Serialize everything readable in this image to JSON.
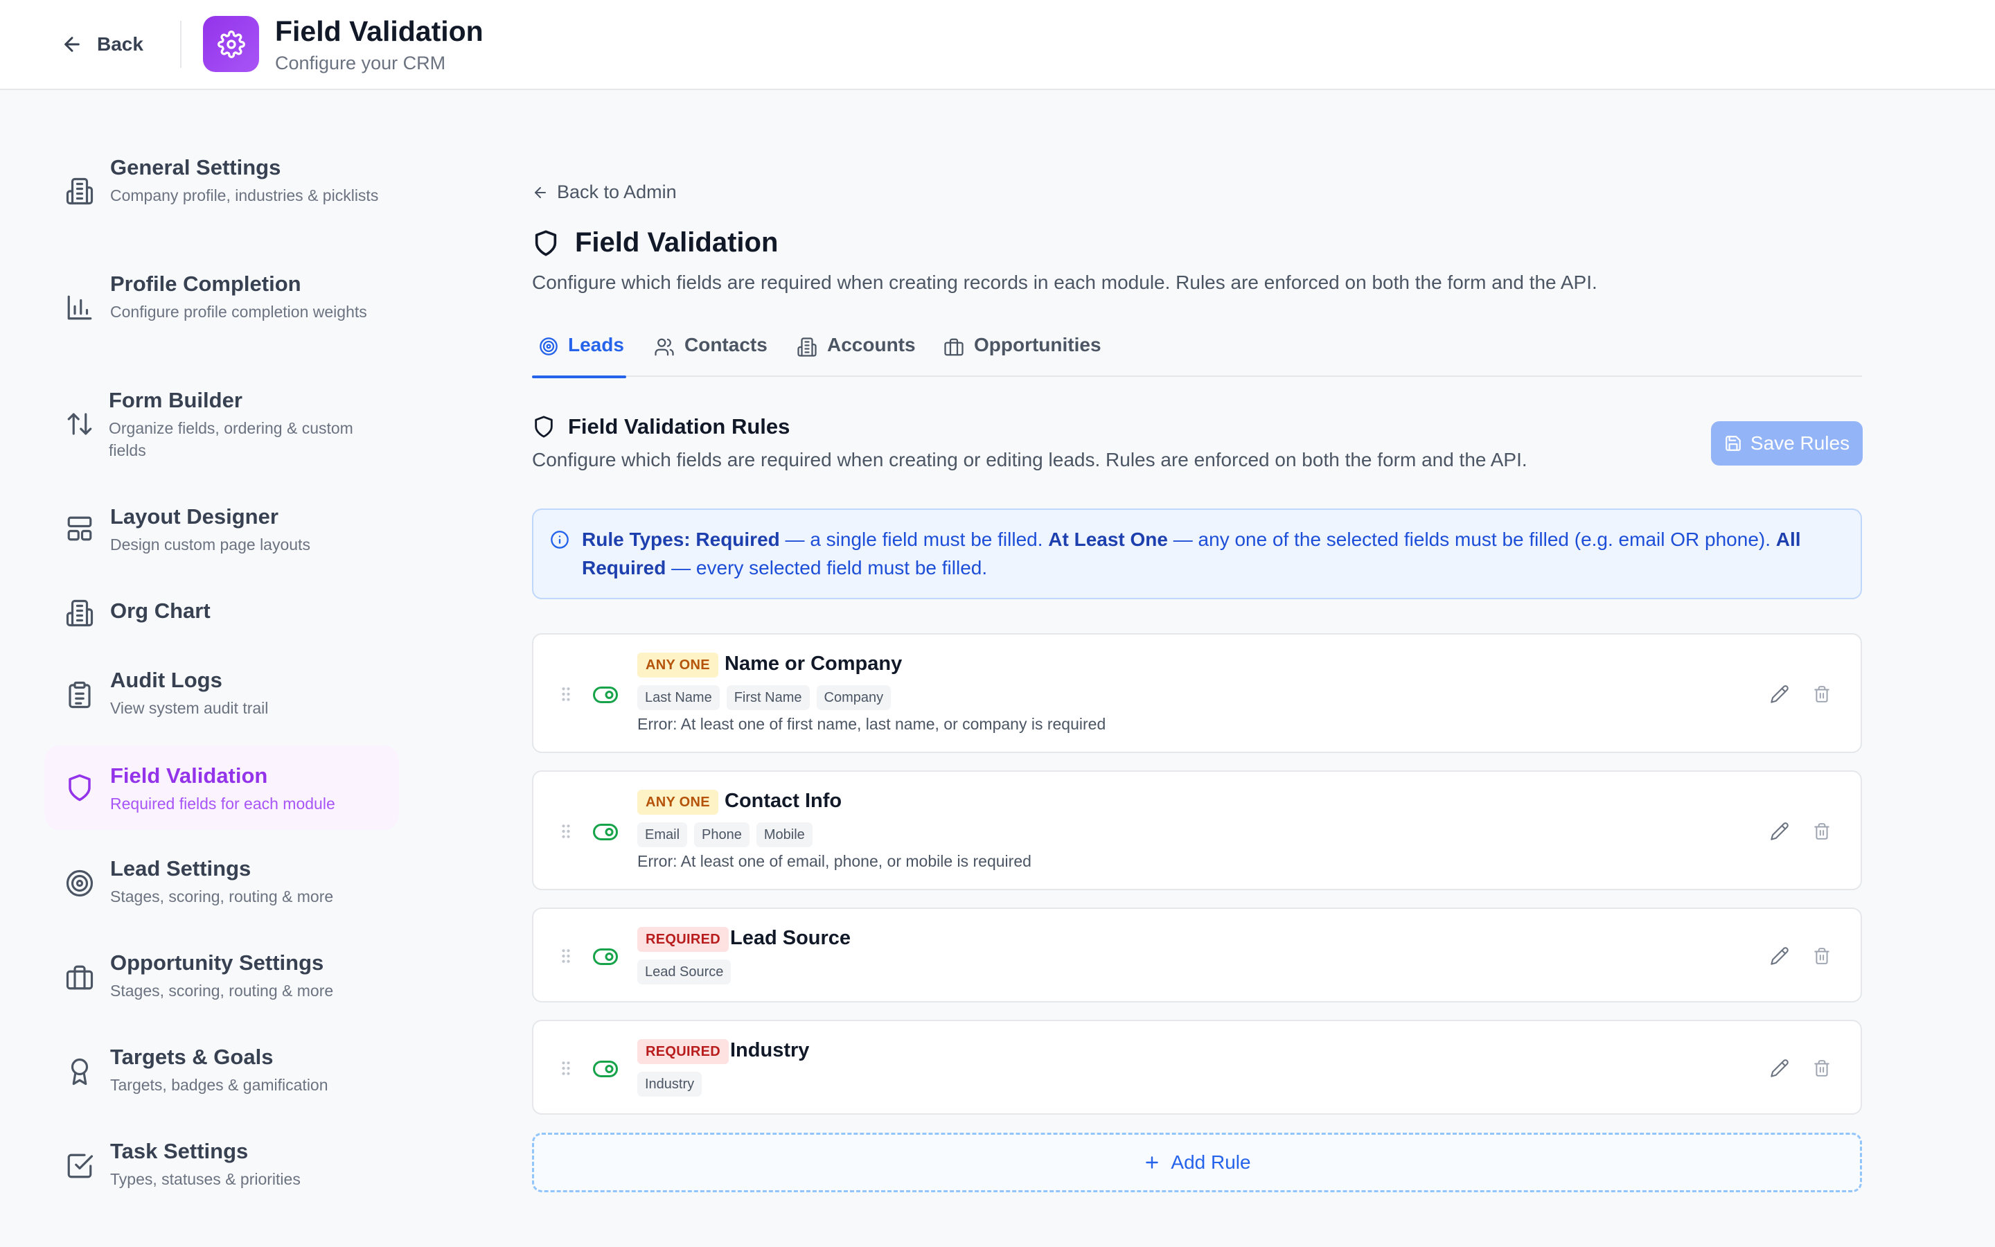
{
  "header": {
    "back_label": "Back",
    "title": "Field Validation",
    "subtitle": "Configure your CRM",
    "app_icon": "gear-icon"
  },
  "sidebar": {
    "items": [
      {
        "label": "General Settings",
        "desc": "Company profile, industries & picklists",
        "icon": "building-icon"
      },
      {
        "label": "Profile Completion",
        "desc": "Configure profile completion weights",
        "icon": "bar-chart-icon"
      },
      {
        "label": "Form Builder",
        "desc": "Organize fields, ordering & custom fields",
        "icon": "sort-arrows-icon"
      },
      {
        "label": "Layout Designer",
        "desc": "Design custom page layouts",
        "icon": "layout-icon"
      },
      {
        "label": "Org Chart",
        "desc": "",
        "icon": "building-icon"
      },
      {
        "label": "Audit Logs",
        "desc": "View system audit trail",
        "icon": "clipboard-icon"
      },
      {
        "label": "Field Validation",
        "desc": "Required fields for each module",
        "icon": "shield-icon",
        "active": true
      },
      {
        "label": "Lead Settings",
        "desc": "Stages, scoring, routing & more",
        "icon": "target-icon"
      },
      {
        "label": "Opportunity Settings",
        "desc": "Stages, scoring, routing & more",
        "icon": "briefcase-icon"
      },
      {
        "label": "Targets & Goals",
        "desc": "Targets, badges & gamification",
        "icon": "award-icon"
      },
      {
        "label": "Task Settings",
        "desc": "Types, statuses & priorities",
        "icon": "check-square-icon"
      }
    ]
  },
  "main": {
    "back_admin": "Back to Admin",
    "title": "Field Validation",
    "description": "Configure which fields are required when creating records in each module. Rules are enforced on both the form and the API.",
    "tabs": [
      {
        "label": "Leads",
        "icon": "target-icon",
        "active": true
      },
      {
        "label": "Contacts",
        "icon": "users-icon"
      },
      {
        "label": "Accounts",
        "icon": "building-icon"
      },
      {
        "label": "Opportunities",
        "icon": "briefcase-icon"
      }
    ],
    "section_title": "Field Validation Rules",
    "section_desc": "Configure which fields are required when creating or editing leads. Rules are enforced on both the form and the API.",
    "save_label": "Save Rules",
    "info": {
      "t1": "Rule Types: Required",
      "t2": " — a single field must be filled. ",
      "t3": "At Least One",
      "t4": " — any one of the selected fields must be filled (e.g. email OR phone). ",
      "t5": "All Required",
      "t6": " — every selected field must be filled."
    },
    "rules": [
      {
        "type": "ANY ONE",
        "name": "Name or Company",
        "fields": [
          "Last Name",
          "First Name",
          "Company"
        ],
        "error": "Error: At least one of first name, last name, or company is required",
        "enabled": true
      },
      {
        "type": "ANY ONE",
        "name": "Contact Info",
        "fields": [
          "Email",
          "Phone",
          "Mobile"
        ],
        "error": "Error: At least one of email, phone, or mobile is required",
        "enabled": true
      },
      {
        "type": "REQUIRED",
        "name": "Lead Source",
        "fields": [
          "Lead Source"
        ],
        "error": "",
        "enabled": true
      },
      {
        "type": "REQUIRED",
        "name": "Industry",
        "fields": [
          "Industry"
        ],
        "error": "",
        "enabled": true
      }
    ],
    "add_rule_label": "Add Rule"
  },
  "colors": {
    "accent_blue": "#2563eb",
    "accent_purple": "#9333ea",
    "toggle_green": "#16a34a",
    "anyone_badge": "#b45309",
    "required_badge": "#b91c1c"
  }
}
